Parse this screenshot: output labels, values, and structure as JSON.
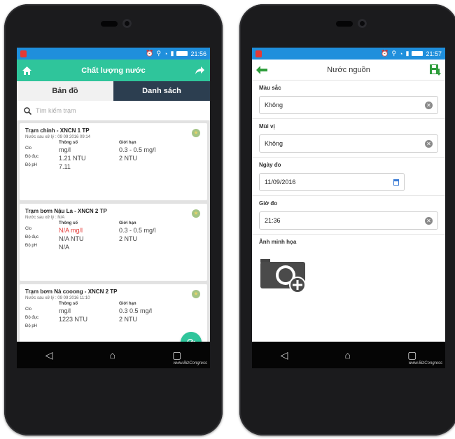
{
  "status": {
    "time_left": "21:56",
    "time_right": "21:57"
  },
  "left": {
    "title": "Chất lượng nước",
    "tabs": [
      "Bản đồ",
      "Danh sách"
    ],
    "search_placeholder": "Tìm kiếm trạm",
    "cards": [
      {
        "title": "Trạm chính - XNCN 1 TP",
        "updated": "Nước sau xử lý : 09 09 2016 09:14",
        "head_param": "Thông số",
        "head_limit": "Giới hạn",
        "rows": [
          {
            "label": "Clo",
            "value": "mg/l",
            "limit": "0.3 - 0.5 mg/l"
          },
          {
            "label": "Độ đục",
            "value": "1.21 NTU",
            "limit": "2 NTU"
          },
          {
            "label": "Độ pH",
            "value": "7.11",
            "limit": ""
          }
        ]
      },
      {
        "title": "Trạm bơm Nậu La - XNCN 2 TP",
        "updated": "Nước sau xử lý : N/A",
        "head_param": "Thông số",
        "head_limit": "Giới hạn",
        "rows": [
          {
            "label": "Clo",
            "value": "N/A mg/l",
            "limit": "0.3 - 0.5 mg/l"
          },
          {
            "label": "Độ đục",
            "value": "N/A NTU",
            "limit": "2 NTU"
          },
          {
            "label": "Độ pH",
            "value": "N/A",
            "limit": ""
          }
        ]
      },
      {
        "title": "Trạm bơm Nà cooong - XNCN 2 TP",
        "updated": "Nước sau xử lý : 09 09 2016 11:10",
        "head_param": "Thông số",
        "head_limit": "Giới hạn",
        "rows": [
          {
            "label": "Clo",
            "value": "mg/l",
            "limit": "0.3 0.5 mg/l"
          },
          {
            "label": "Độ đục",
            "value": "1223 NTU",
            "limit": "2 NTU"
          },
          {
            "label": "Độ pH",
            "value": "",
            "limit": ""
          }
        ]
      }
    ]
  },
  "right": {
    "title": "Nước nguồn",
    "fields": [
      {
        "label": "Màu sắc",
        "value": "Không"
      },
      {
        "label": "Mùi vị",
        "value": "Không"
      },
      {
        "label": "Ngày đo",
        "value": "11/09/2016"
      },
      {
        "label": "Giờ đo",
        "value": "21:36"
      }
    ],
    "photo_label": "Ảnh minh họa"
  },
  "watermark": "www.BizCongress"
}
